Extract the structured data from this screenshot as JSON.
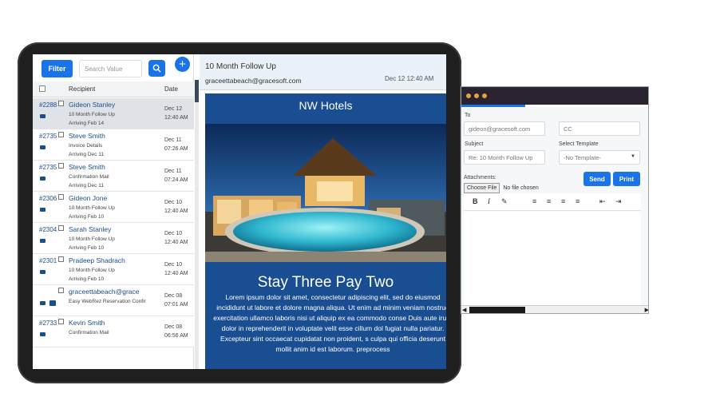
{
  "list": {
    "filter_label": "Filter",
    "search_placeholder": "Search Value",
    "add_label": "+",
    "header_recipient": "Recipient",
    "header_date": "Date",
    "rows": [
      {
        "id": "#2288",
        "name": "Gideon Stanley",
        "subject": "10 Month Follow Up",
        "arriving": "Arriving Feb 14",
        "date": "Dec 12",
        "time": "12:40 AM",
        "selected": true
      },
      {
        "id": "#2735",
        "name": "Steve Smith",
        "subject": "Invoice Details",
        "arriving": "Arriving Dec 11",
        "date": "Dec 11",
        "time": "07:26 AM",
        "selected": false
      },
      {
        "id": "#2735",
        "name": "Steve Smith",
        "subject": "Confirmation Mail",
        "arriving": "Arriving Dec 11",
        "date": "Dec 11",
        "time": "07:24 AM",
        "selected": false
      },
      {
        "id": "#2306",
        "name": "Gideon Jone",
        "subject": "10 Month Follow Up",
        "arriving": "Arriving Feb 10",
        "date": "Dec 10",
        "time": "12:40 AM",
        "selected": false
      },
      {
        "id": "#2304",
        "name": "Sarah Stanley",
        "subject": "10 Month Follow Up",
        "arriving": "Arriving Feb 10",
        "date": "Dec 10",
        "time": "12:40 AM",
        "selected": false
      },
      {
        "id": "#2301",
        "name": "Pradeep Shadrach",
        "subject": "10 Month Follow Up",
        "arriving": "Arriving Feb 10",
        "date": "Dec 10",
        "time": "12:40 AM",
        "selected": false
      },
      {
        "id": "",
        "name": "graceettabeach@grace",
        "subject": "Easy WebRez Reservation Confir",
        "arriving": "",
        "date": "Dec 08",
        "time": "07:01 AM",
        "selected": false
      },
      {
        "id": "#2733",
        "name": "Kevin Smith",
        "subject": "Confirmation Mail",
        "arriving": "",
        "date": "Dec 08",
        "time": "06:56 AM",
        "selected": false
      }
    ]
  },
  "preview": {
    "title": "10 Month Follow Up",
    "from": "graceettabeach@gracesoft.com",
    "date": "Dec 12 12:40 AM",
    "brand": "NW Hotels",
    "promo_title": "Stay Three Pay Two",
    "body": "Lorem ipsum dolor sit amet, consectetur adipiscing elit, sed do eiusmod incididunt ut labore et dolore magna aliqua. Ut enim ad minim veniam nostrud exercitation ullamco laboris nisi ut aliquip ex ea commodo conse Duis aute irure dolor in reprehenderit in voluptate velit esse cillum dol fugiat nulla pariatur. Excepteur sint occaecat cupidatat non proident, s culpa qui officia deserunt mollit anim id est laborum. preprocess"
  },
  "compose": {
    "to_label": "To",
    "to_value": "gideon@gracesoft.com",
    "cc_placeholder": "CC",
    "subject_label": "Subject",
    "subject_value": "Re: 10 Month Follow Up",
    "template_label": "Select Template",
    "template_value": "-No Template-",
    "attachments_label": "Attachments:",
    "choose_file_label": "Choose File",
    "no_file_label": "No file chosen",
    "send_label": "Send",
    "print_label": "Print",
    "toolbar": [
      "B",
      "I",
      "✎",
      "≡",
      "≡",
      "≡",
      "≡",
      "⇤",
      "⇥"
    ]
  },
  "colors": {
    "accent": "#1a73e8",
    "email_bg": "#1a4e93",
    "link": "#1a4f8b",
    "title_bar": "#2b2230",
    "window_dot": "#e0a43a"
  }
}
